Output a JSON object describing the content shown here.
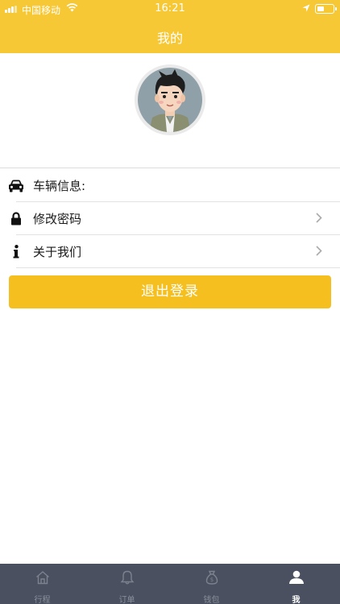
{
  "status_bar": {
    "carrier": "中国移动",
    "time": "16:21"
  },
  "header": {
    "title": "我的"
  },
  "profile": {
    "avatar_icon": "avatar-icon"
  },
  "menu": {
    "items": [
      {
        "label": "车辆信息:",
        "icon": "car-icon",
        "has_chevron": false
      },
      {
        "label": "修改密码",
        "icon": "lock-icon",
        "has_chevron": true
      },
      {
        "label": "关于我们",
        "icon": "info-icon",
        "has_chevron": true
      }
    ]
  },
  "logout_button": {
    "label": "退出登录"
  },
  "tabbar": {
    "tabs": [
      {
        "label": "行程",
        "icon": "home-icon",
        "active": false
      },
      {
        "label": "订单",
        "icon": "bell-icon",
        "active": false
      },
      {
        "label": "钱包",
        "icon": "money-bag-icon",
        "active": false
      },
      {
        "label": "我",
        "icon": "person-icon",
        "active": true
      }
    ]
  },
  "colors": {
    "accent": "#f7c836",
    "button": "#f5c01f",
    "tabbar": "#4a5060"
  }
}
